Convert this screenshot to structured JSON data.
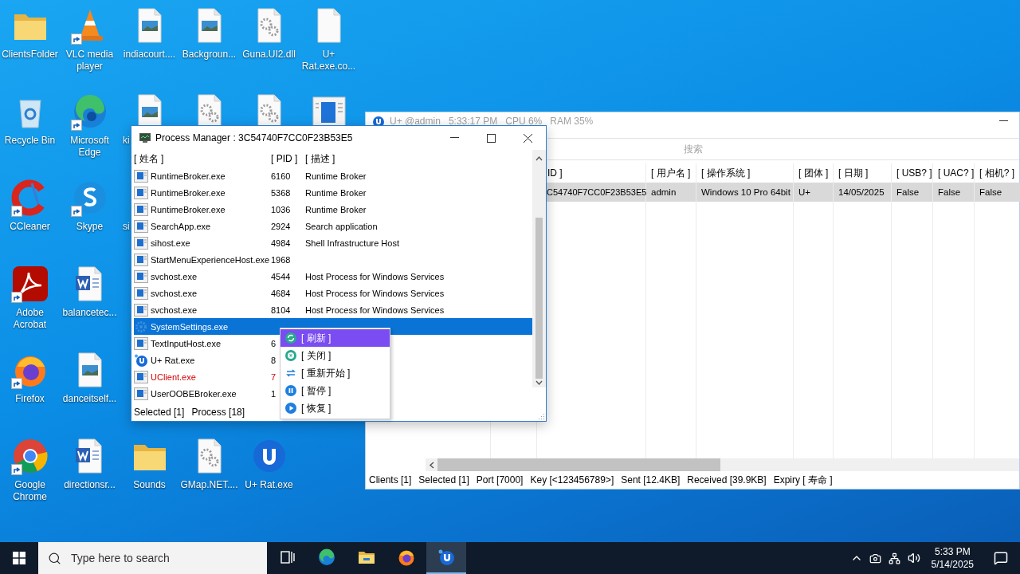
{
  "desktop_icons": [
    {
      "label": "ClientsFolder",
      "kind": "folder",
      "shortcut": false
    },
    {
      "label": "VLC media player",
      "kind": "cone",
      "shortcut": true
    },
    {
      "label": "indiacourt....",
      "kind": "image",
      "shortcut": false
    },
    {
      "label": "Backgroun...",
      "kind": "image",
      "shortcut": false
    },
    {
      "label": "Guna.UI2.dll",
      "kind": "gears",
      "shortcut": false
    },
    {
      "label": "U+ Rat.exe.co...",
      "kind": "file",
      "shortcut": false
    },
    {
      "label": "Recycle Bin",
      "kind": "bin",
      "shortcut": false
    },
    {
      "label": "Microsoft Edge",
      "kind": "edge",
      "shortcut": true
    },
    {
      "label": "ki",
      "kind": "image",
      "shortcut": false,
      "clipped": true
    },
    {
      "kind": "gears",
      "shortcut": false
    },
    {
      "kind": "gears",
      "shortcut": false
    },
    {
      "kind": "app",
      "shortcut": false
    },
    {
      "label": "CCleaner",
      "kind": "ccleaner",
      "shortcut": true
    },
    {
      "label": "Skype",
      "kind": "skype",
      "shortcut": true
    },
    {
      "label": "si",
      "kind": "covered",
      "shortcut": false,
      "clipped": true
    },
    {
      "label": "Adobe Acrobat",
      "kind": "acrobat",
      "shortcut": true
    },
    {
      "label": "balancetec...",
      "kind": "word",
      "shortcut": false
    },
    {
      "label": "Firefox",
      "kind": "firefox",
      "shortcut": true
    },
    {
      "label": "danceitself...",
      "kind": "image",
      "shortcut": false
    },
    {
      "label": "Google Chrome",
      "kind": "chrome",
      "shortcut": true
    },
    {
      "label": "directionsr...",
      "kind": "word",
      "shortcut": false
    },
    {
      "label": "Sounds",
      "kind": "folder",
      "shortcut": false
    },
    {
      "label": "GMap.NET....",
      "kind": "gears",
      "shortcut": false
    },
    {
      "label": "U+ Rat.exe",
      "kind": "uplus",
      "shortcut": false
    }
  ],
  "client_window": {
    "title": "U+ @admin   5:33:17 PM   CPU 6%   RAM 35%",
    "search_placeholder": "搜索",
    "columns": [
      "ID ]",
      "[ 用户名 ]",
      "[ 操作系统 ]",
      "[ 团体 ]",
      "[ 日期 ]",
      "[ USB? ]",
      "[ UAC? ]",
      "[ 相机? ]"
    ],
    "rows": [
      {
        "cells": [
          "C54740F7CC0F23B53E5",
          "admin",
          "Windows 10 Pro 64bit",
          "U+",
          "14/05/2025",
          "False",
          "False",
          "False"
        ],
        "selected": true
      }
    ],
    "status": [
      "Clients [1]",
      "Selected [1]",
      "Port [7000]",
      "Key [<123456789>]",
      "Sent [12.4KB]",
      "Received [39.9KB]",
      "Expiry [ 寿命 ]"
    ]
  },
  "process_manager": {
    "title": "Process Manager : 3C54740F7CC0F23B53E5",
    "columns": [
      "[ 姓名 ]",
      "[ PID ]",
      "[ 描述 ]"
    ],
    "rows": [
      {
        "name": "RuntimeBroker.exe",
        "pid": "6160",
        "description": "Runtime Broker",
        "kind": "window",
        "selected": false
      },
      {
        "name": "RuntimeBroker.exe",
        "pid": "5368",
        "description": "Runtime Broker",
        "kind": "window",
        "selected": false
      },
      {
        "name": "RuntimeBroker.exe",
        "pid": "1036",
        "description": "Runtime Broker",
        "kind": "window",
        "selected": false
      },
      {
        "name": "SearchApp.exe",
        "pid": "2924",
        "description": "Search application",
        "kind": "window",
        "selected": false
      },
      {
        "name": "sihost.exe",
        "pid": "4984",
        "description": "Shell Infrastructure Host",
        "kind": "window",
        "selected": false
      },
      {
        "name": "StartMenuExperienceHost.exe",
        "pid": "1968",
        "kind": "window",
        "selected": false
      },
      {
        "name": "svchost.exe",
        "pid": "4544",
        "description": "Host Process for Windows Services",
        "kind": "window",
        "selected": false
      },
      {
        "name": "svchost.exe",
        "pid": "4684",
        "description": "Host Process for Windows Services",
        "kind": "window",
        "selected": false
      },
      {
        "name": "svchost.exe",
        "pid": "8104",
        "description": "Host Process for Windows Services",
        "kind": "window",
        "selected": false
      },
      {
        "name": "SystemSettings.exe",
        "kind": "gear",
        "selected": true
      },
      {
        "name": "TextInputHost.exe",
        "pid": "6",
        "kind": "window",
        "selected": false
      },
      {
        "name": "U+ Rat.exe",
        "pid": "8",
        "kind": "uplus",
        "selected": false
      },
      {
        "name": "UClient.exe",
        "pid": "7",
        "kind": "window",
        "color": "#d40000",
        "selected": false
      },
      {
        "name": "UserOOBEBroker.exe",
        "pid": "1",
        "kind": "window",
        "selected": false
      }
    ],
    "status": [
      "Selected [1]",
      "Process [18]"
    ]
  },
  "context_menu": [
    {
      "label": "[ 刷新 ]",
      "kind": "refresh",
      "selected": true
    },
    {
      "label": "[ 关闭 ]",
      "kind": "close",
      "selected": false
    },
    {
      "label": "[ 重新开始 ]",
      "kind": "swap",
      "selected": false
    },
    {
      "label": "[ 暂停 ]",
      "kind": "pause",
      "selected": false
    },
    {
      "label": "[ 恢复 ]",
      "kind": "play",
      "selected": false
    }
  ],
  "taskbar": {
    "search_placeholder": "Type here to search",
    "apps": [
      {
        "kind": "taskview",
        "selected": false
      },
      {
        "kind": "edge",
        "selected": false
      },
      {
        "kind": "explorer",
        "selected": false
      },
      {
        "kind": "firefox",
        "selected": false
      },
      {
        "kind": "uplus",
        "selected": true
      }
    ],
    "time": "5:33 PM",
    "date": "5/14/2025"
  }
}
